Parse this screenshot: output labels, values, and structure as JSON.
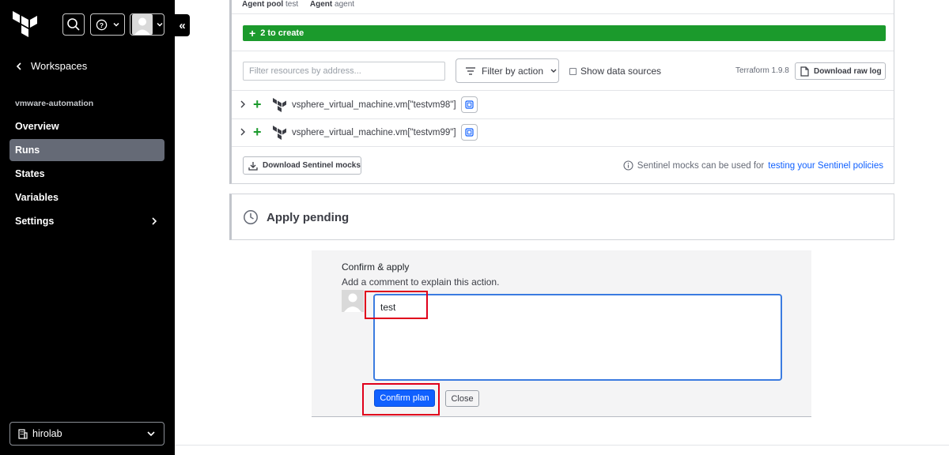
{
  "sidebar": {
    "back_label": "Workspaces",
    "workspace_name": "vmware-automation",
    "nav_items": [
      {
        "label": "Overview"
      },
      {
        "label": "Runs"
      },
      {
        "label": "States"
      },
      {
        "label": "Variables"
      },
      {
        "label": "Settings"
      }
    ],
    "active_item": "Runs",
    "organization": "hirolab"
  },
  "plan": {
    "agent_pool_label": "Agent pool",
    "agent_pool_value": "test",
    "agent_label": "Agent",
    "agent_value": "agent",
    "create_summary": "2 to create",
    "filter_placeholder": "Filter resources by address...",
    "filter_action_label": "Filter by action",
    "show_data_sources_label": "Show data sources",
    "terraform_version": "Terraform 1.9.8",
    "download_raw_log_label": "Download raw log",
    "resources": [
      {
        "address": "vsphere_virtual_machine.vm[\"testvm98\"]",
        "action": "create"
      },
      {
        "address": "vsphere_virtual_machine.vm[\"testvm99\"]",
        "action": "create"
      }
    ],
    "download_mocks_label": "Download Sentinel mocks",
    "mocks_info_text": "Sentinel mocks can be used for",
    "mocks_info_link": "testing your Sentinel policies"
  },
  "apply": {
    "status_title": "Apply pending"
  },
  "confirm": {
    "title": "Confirm & apply",
    "subtitle": "Add a comment to explain this action.",
    "comment_value": "test",
    "confirm_label": "Confirm plan",
    "close_label": "Close"
  },
  "colors": {
    "sidebar_bg": "#000000",
    "create_green": "#1b9a2c",
    "primary_blue": "#1060ff",
    "highlight_red": "#e0001b"
  }
}
